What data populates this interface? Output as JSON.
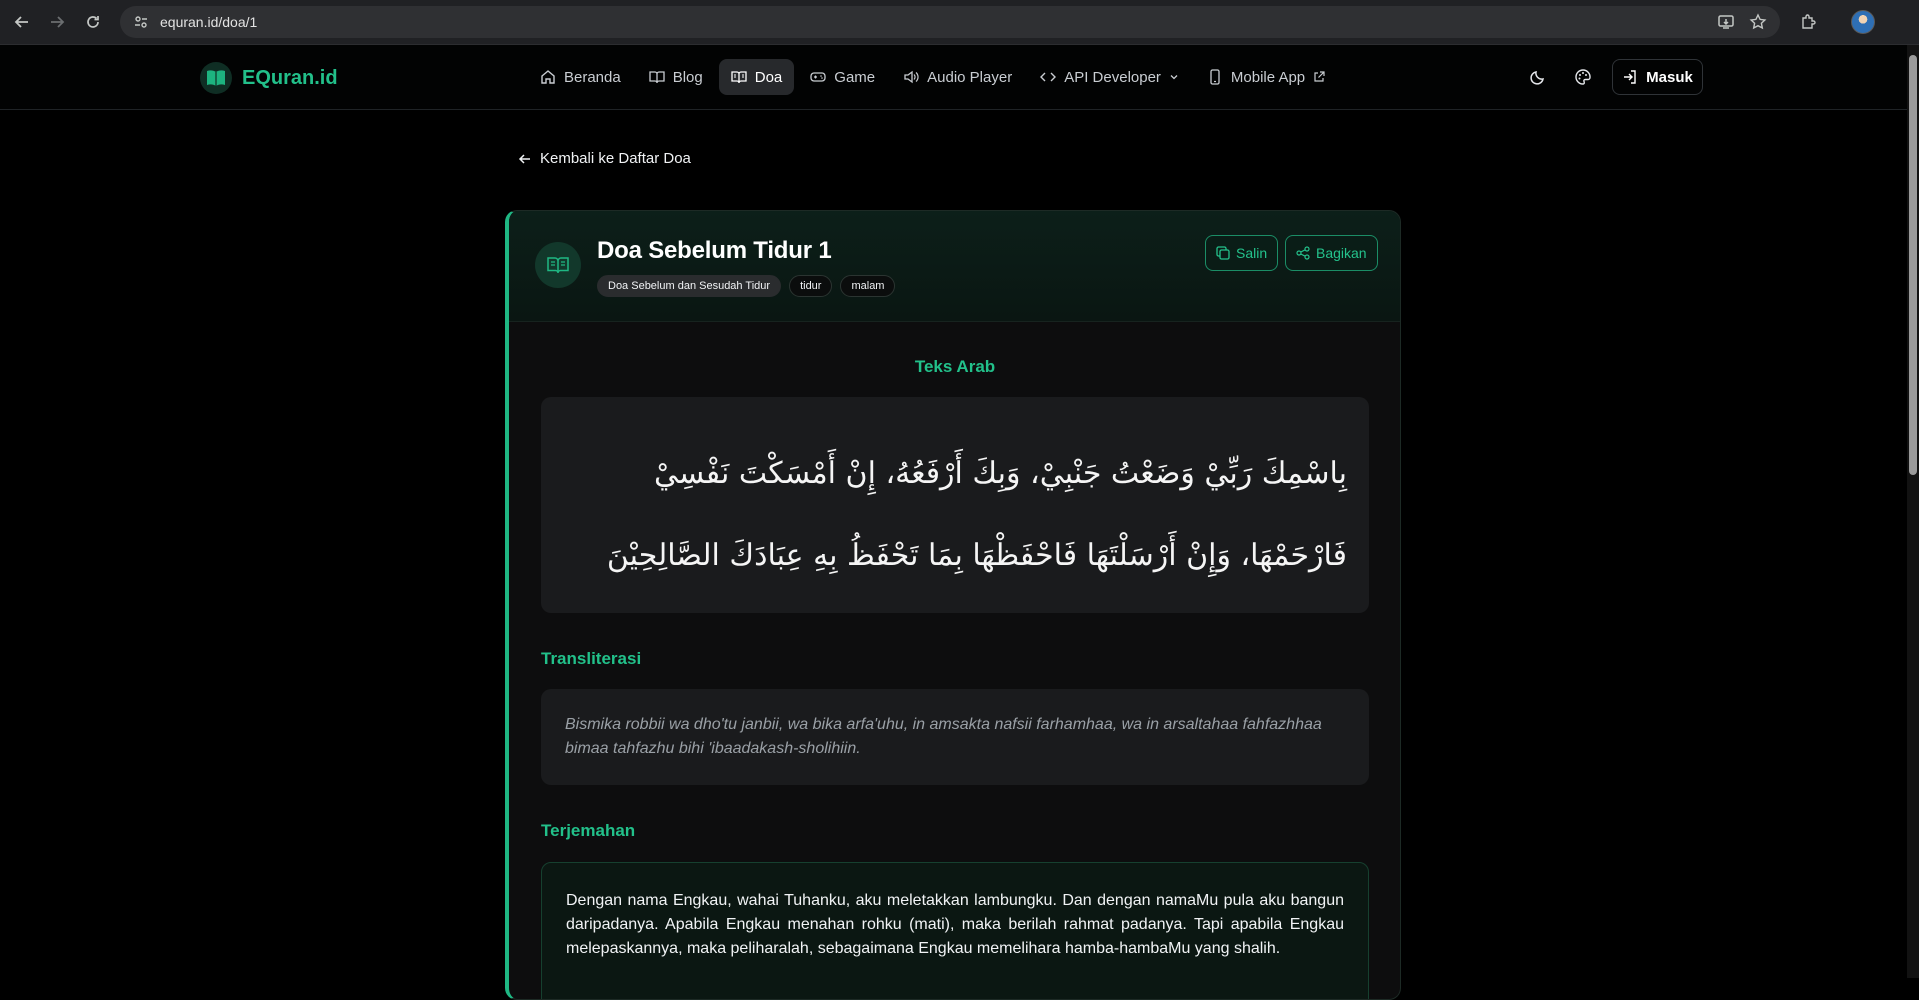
{
  "browser": {
    "url": "equran.id/doa/1"
  },
  "site": {
    "logo_text": "EQuran.id",
    "brand_color": "#22c08a",
    "nav": [
      {
        "label": "Beranda",
        "icon": "home-icon"
      },
      {
        "label": "Blog",
        "icon": "book-open-icon"
      },
      {
        "label": "Doa",
        "icon": "book-icon",
        "active": true
      },
      {
        "label": "Game",
        "icon": "gamepad-icon"
      },
      {
        "label": "Audio Player",
        "icon": "speaker-icon"
      },
      {
        "label": "API Developer",
        "icon": "code-icon"
      },
      {
        "label": "Mobile App",
        "icon": "smartphone-icon"
      }
    ],
    "login_label": "Masuk"
  },
  "page": {
    "back_label": "Kembali ke Daftar Doa",
    "title": "Doa Sebelum Tidur 1",
    "tags": [
      "Doa Sebelum dan Sesudah Tidur",
      "tidur",
      "malam"
    ],
    "copy_label": "Salin",
    "share_label": "Bagikan",
    "arab_heading": "Teks Arab",
    "arab_text": "بِاسْمِكَ رَبِّيْ وَضَعْتُ جَنْبِيْ، وَبِكَ أَرْفَعُهُ، إِنْ أَمْسَكْتَ نَفْسِيْ فَارْحَمْهَا، وَإِنْ أَرْسَلْتَهَا فَاحْفَظْهَا بِمَا تَحْفَظُ بِهِ عِبَادَكَ الصَّالِحِيْنَ",
    "translit_heading": "Transliterasi",
    "translit_text": "Bismika robbii wa dho'tu janbii, wa bika arfa'uhu, in amsakta nafsii farhamhaa, wa in arsaltahaa fahfazhhaa bimaa tahfazhu bihi 'ibaadakash-sholihiin.",
    "translation_heading": "Terjemahan",
    "translation_text": "Dengan nama Engkau, wahai Tuhanku, aku meletakkan lambungku. Dan dengan namaMu pula aku bangun daripadanya. Apabila Engkau menahan rohku (mati), maka berilah rahmat padanya. Tapi apabila Engkau melepaskannya, maka peliharalah, sebagaimana Engkau memelihara hamba-hambaMu yang shalih."
  }
}
